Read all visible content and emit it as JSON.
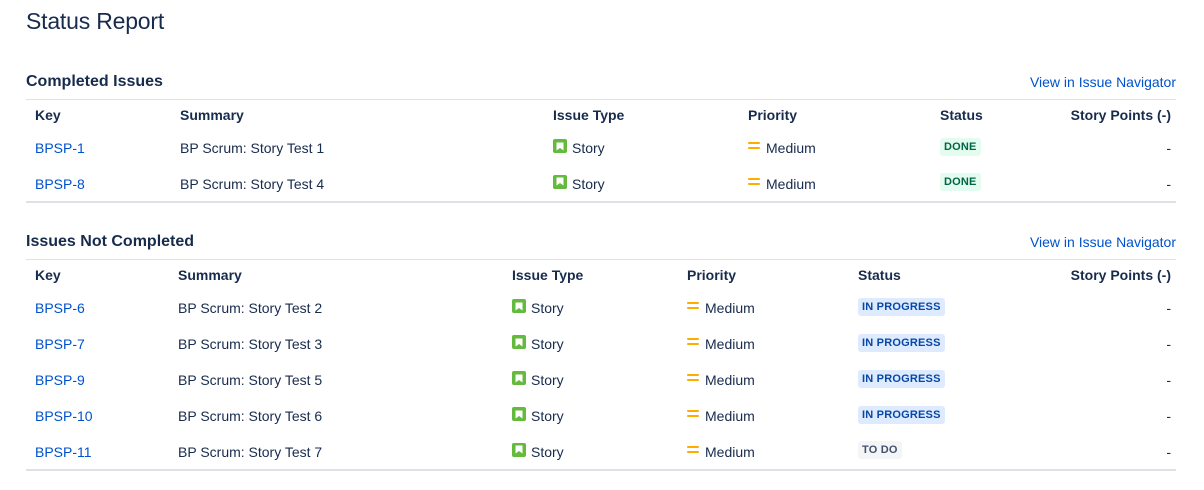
{
  "page": {
    "title": "Status Report"
  },
  "columns": {
    "key": "Key",
    "summary": "Summary",
    "issue_type": "Issue Type",
    "priority": "Priority",
    "status": "Status",
    "story_points": "Story Points (-)"
  },
  "completed": {
    "title": "Completed Issues",
    "link": "View in Issue Navigator",
    "rows": [
      {
        "key": "BPSP-1",
        "summary": "BP Scrum: Story Test 1",
        "type": "Story",
        "priority": "Medium",
        "status": "DONE",
        "points": "-"
      },
      {
        "key": "BPSP-8",
        "summary": "BP Scrum: Story Test 4",
        "type": "Story",
        "priority": "Medium",
        "status": "DONE",
        "points": "-"
      }
    ]
  },
  "not_completed": {
    "title": "Issues Not Completed",
    "link": "View in Issue Navigator",
    "rows": [
      {
        "key": "BPSP-6",
        "summary": "BP Scrum: Story Test 2",
        "type": "Story",
        "priority": "Medium",
        "status": "IN PROGRESS",
        "points": "-"
      },
      {
        "key": "BPSP-7",
        "summary": "BP Scrum: Story Test 3",
        "type": "Story",
        "priority": "Medium",
        "status": "IN PROGRESS",
        "points": "-"
      },
      {
        "key": "BPSP-9",
        "summary": "BP Scrum: Story Test 5",
        "type": "Story",
        "priority": "Medium",
        "status": "IN PROGRESS",
        "points": "-"
      },
      {
        "key": "BPSP-10",
        "summary": "BP Scrum: Story Test 6",
        "type": "Story",
        "priority": "Medium",
        "status": "IN PROGRESS",
        "points": "-"
      },
      {
        "key": "BPSP-11",
        "summary": "BP Scrum: Story Test 7",
        "type": "Story",
        "priority": "Medium",
        "status": "TO DO",
        "points": "-"
      }
    ]
  },
  "icons": {
    "issue_type": "story-icon",
    "priority": "priority-medium-icon"
  },
  "colors": {
    "link": "#0052cc",
    "story": "#63ba3c",
    "priority_medium": "#ffab00",
    "done": "#006644",
    "in_progress": "#0747a6",
    "todo": "#42526e"
  }
}
